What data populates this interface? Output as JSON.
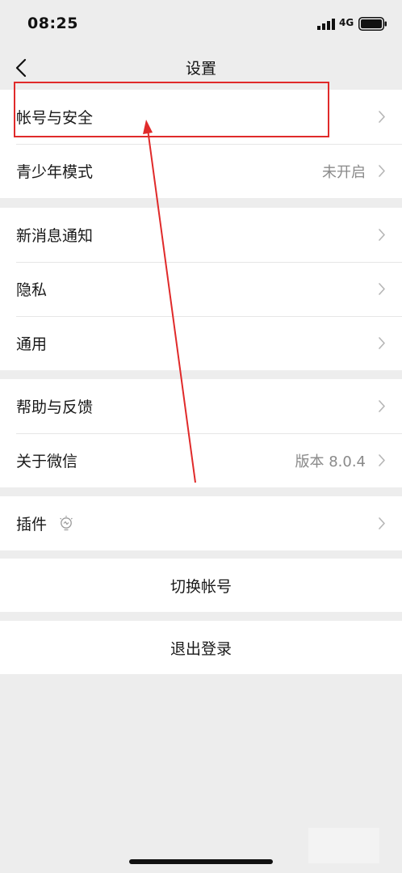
{
  "status_bar": {
    "time": "08:25",
    "network": "4G"
  },
  "nav": {
    "title": "设置"
  },
  "group1": [
    {
      "label": "帐号与安全",
      "value": ""
    },
    {
      "label": "青少年模式",
      "value": "未开启"
    }
  ],
  "group2": [
    {
      "label": "新消息通知"
    },
    {
      "label": "隐私"
    },
    {
      "label": "通用"
    }
  ],
  "group3": [
    {
      "label": "帮助与反馈",
      "value": ""
    },
    {
      "label": "关于微信",
      "value": "版本 8.0.4"
    }
  ],
  "group4": [
    {
      "label": "插件"
    }
  ],
  "actions": {
    "switch_account": "切换帐号",
    "logout": "退出登录"
  },
  "colors": {
    "background": "#ededed",
    "annotation": "#e02a2a"
  }
}
